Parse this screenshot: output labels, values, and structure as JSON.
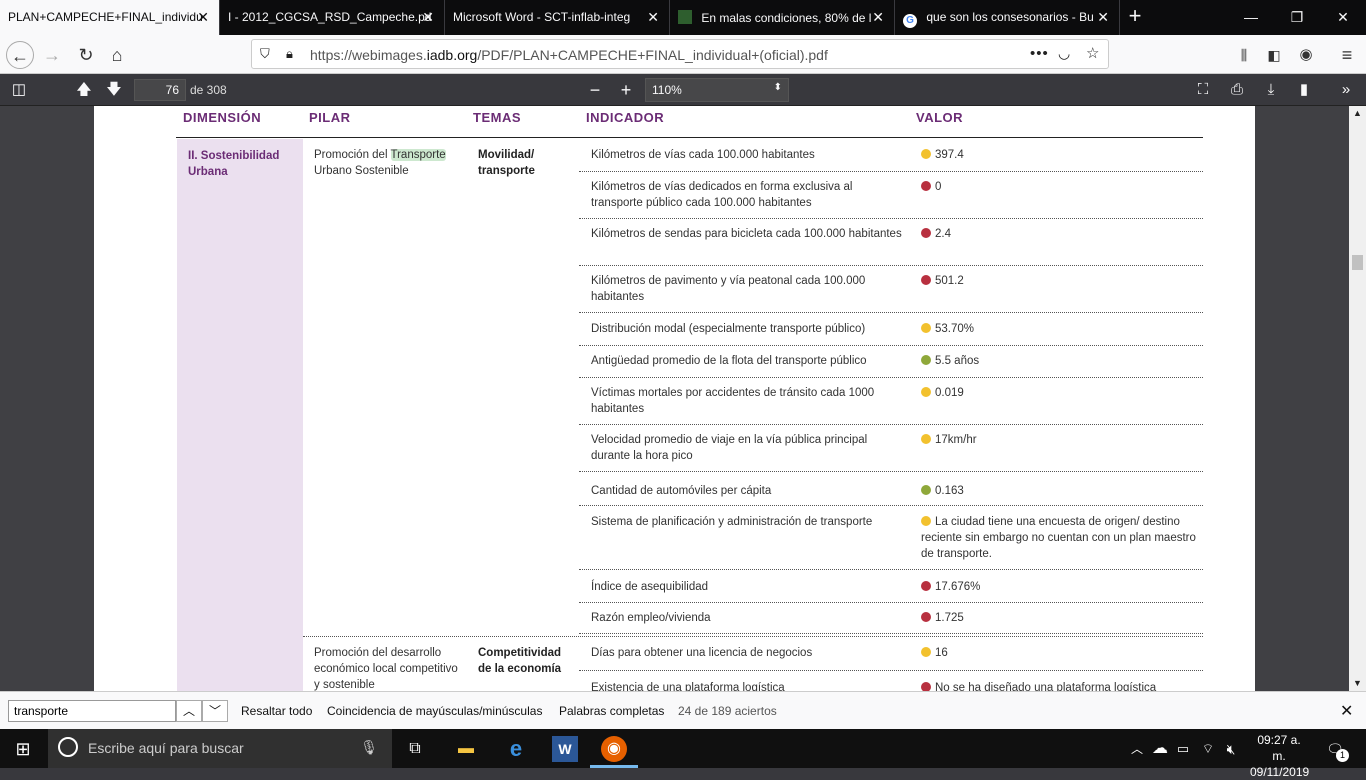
{
  "tabs": [
    {
      "title": "PLAN+CAMPECHE+FINAL_individu",
      "active": true
    },
    {
      "title": "I - 2012_CGCSA_RSD_Campeche.pd",
      "active": false
    },
    {
      "title": "Microsoft Word - SCT-inflab-integ",
      "active": false
    },
    {
      "title": "En malas condiciones, 80% de l",
      "active": false
    },
    {
      "title": "que son los consesonarios - Bu",
      "active": false
    }
  ],
  "url": {
    "prefix": "https://webimages.",
    "domain": "iadb.org",
    "path": "/PDF/PLAN+CAMPECHE+FINAL_individual+(oficial).pdf"
  },
  "pdf_toolbar": {
    "page_number": "76",
    "page_of": "de 308",
    "zoom": "110%"
  },
  "table": {
    "headers": {
      "dimension": "DIMENSIÓN",
      "pillar": "PILAR",
      "themes": "TEMAS",
      "indicator": "INDICADOR",
      "value": "VALOR"
    },
    "dimension": "II. Sostenibilidad Urbana",
    "pillar1": {
      "before": "Promoción del ",
      "highlight": "Transporte",
      "after": " Urbano Sostenible"
    },
    "theme1": "Movilidad/ transporte",
    "rows": [
      {
        "indicator": "Kilómetros de vías cada 100.000 habitantes",
        "value": "397.4",
        "status": "yellow"
      },
      {
        "indicator": "Kilómetros de vías dedicados en forma exclusiva al transporte público cada 100.000 habitantes",
        "value": "0",
        "status": "red"
      },
      {
        "indicator": "Kilómetros de sendas para bicicleta cada 100.000 habitantes",
        "value": "2.4",
        "status": "red"
      },
      {
        "indicator": "Kilómetros de pavimento y vía peatonal cada 100.000 habitantes",
        "value": "501.2",
        "status": "red"
      },
      {
        "indicator": "Distribución modal (especialmente transporte público)",
        "value": "53.70%",
        "status": "yellow"
      },
      {
        "indicator": "Antigüedad promedio de la flota del transporte público",
        "value": "5.5 años",
        "status": "green"
      },
      {
        "indicator": "Víctimas mortales por accidentes de tránsito cada 1000 habitantes",
        "value": "0.019",
        "status": "yellow"
      },
      {
        "indicator": "Velocidad promedio de viaje en la vía pública principal durante la hora pico",
        "value": "17km/hr",
        "status": "yellow"
      },
      {
        "indicator": "Cantidad de automóviles per cápita",
        "value": "0.163",
        "status": "green"
      },
      {
        "indicator": "Sistema de planificación y administración de transporte",
        "value": "La ciudad tiene una encuesta de origen/ destino reciente sin embargo no cuentan con un plan maestro de transporte.",
        "status": "yellow"
      },
      {
        "indicator": "Índice de asequibilidad",
        "value": "17.676%",
        "status": "red"
      },
      {
        "indicator": "Razón empleo/vivienda",
        "value": "1.725",
        "status": "red"
      },
      {
        "indicator": "Días para obtener una licencia de negocios",
        "value": "16",
        "status": "yellow"
      },
      {
        "indicator": "Existencia de una plataforma logística",
        "value": "No se ha diseñado una plataforma logística",
        "status": "red"
      }
    ],
    "pillar2": "Promoción del desarrollo económico local competitivo y sostenible",
    "theme2": "Competitividad de la economía"
  },
  "status_colors": {
    "yellow": "#f2c12e",
    "red": "#b8303f",
    "green": "#8fa83a"
  },
  "findbar": {
    "query": "transporte",
    "highlight_all": "Resaltar todo",
    "match_case": "Coincidencia de mayúsculas/minúsculas",
    "whole_words": "Palabras completas",
    "result": "24 de 189 aciertos"
  },
  "taskbar": {
    "search_placeholder": "Escribe aquí para buscar",
    "time": "09:27 a. m.",
    "date": "09/11/2019",
    "notifications": "1"
  }
}
